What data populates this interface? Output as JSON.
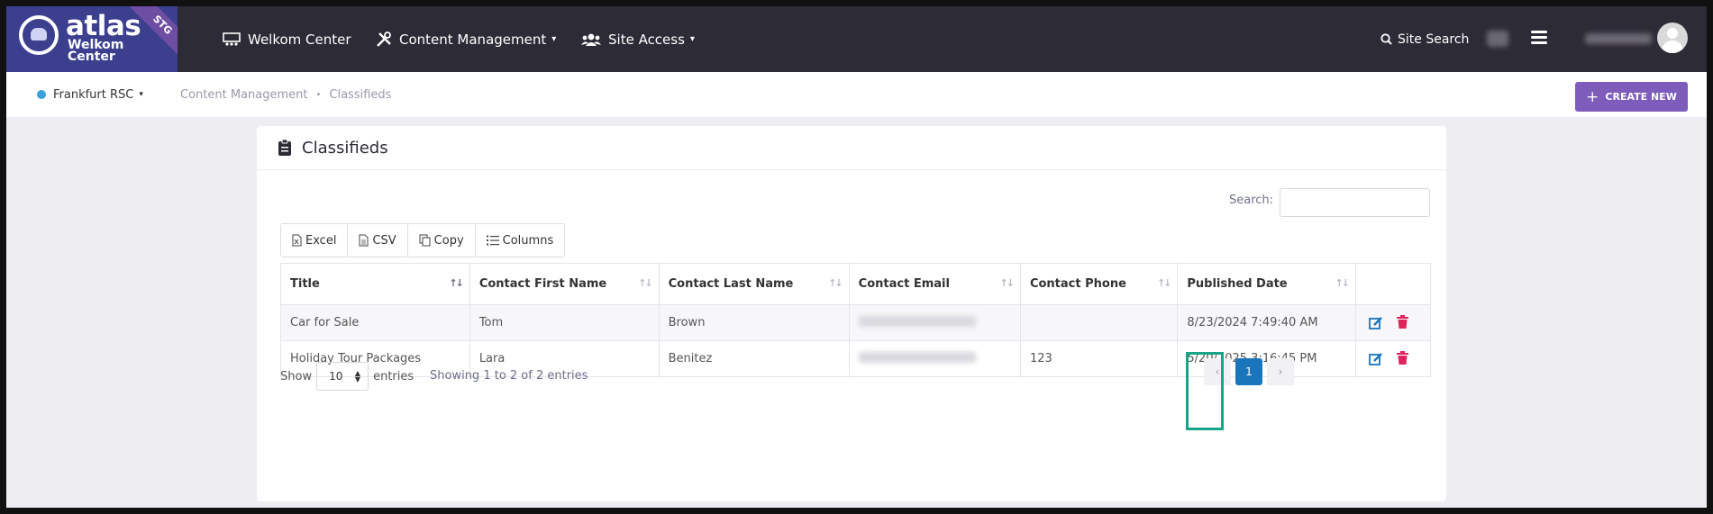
{
  "brand": {
    "line1": "atlas",
    "line2": "Welkom",
    "line3": "Center",
    "badge": "STG"
  },
  "nav": {
    "items": [
      {
        "label": "Welkom Center",
        "icon": "presentation-board-icon"
      },
      {
        "label": "Content Management",
        "icon": "tools-icon"
      },
      {
        "label": "Site Access",
        "icon": "users-icon"
      }
    ],
    "site_search": "Site Search"
  },
  "subbar": {
    "site": "Frankfurt RSC",
    "breadcrumb": [
      "Content Management",
      "Classifieds"
    ],
    "create_new": "CREATE NEW"
  },
  "card": {
    "title": "Classifieds",
    "search_label": "Search:",
    "search_value": "",
    "export_buttons": [
      {
        "label": "Excel",
        "icon": "excel-file-icon"
      },
      {
        "label": "CSV",
        "icon": "csv-file-icon"
      },
      {
        "label": "Copy",
        "icon": "copy-icon"
      },
      {
        "label": "Columns",
        "icon": "list-icon"
      }
    ],
    "columns": [
      "Title",
      "Contact First Name",
      "Contact Last Name",
      "Contact Email",
      "Contact Phone",
      "Published Date"
    ],
    "rows": [
      {
        "title": "Car for Sale",
        "first": "Tom",
        "last": "Brown",
        "phone": "",
        "published": "8/23/2024 7:49:40 AM"
      },
      {
        "title": "Holiday Tour Packages",
        "first": "Lara",
        "last": "Benitez",
        "phone": "123",
        "published": "5/20/2025 3:16:45 PM"
      }
    ],
    "show_label": "Show",
    "page_size": "10",
    "entries_label": "entries",
    "info": "Showing 1 to 2 of 2 entries",
    "pager": {
      "prev": "‹",
      "current": "1",
      "next": "›"
    }
  },
  "colors": {
    "nav_bg": "#2d2b36",
    "create_button": "#7d5cbc",
    "delete": "#e0245e",
    "edit": "#1a75bb",
    "highlight": "#17a589"
  }
}
